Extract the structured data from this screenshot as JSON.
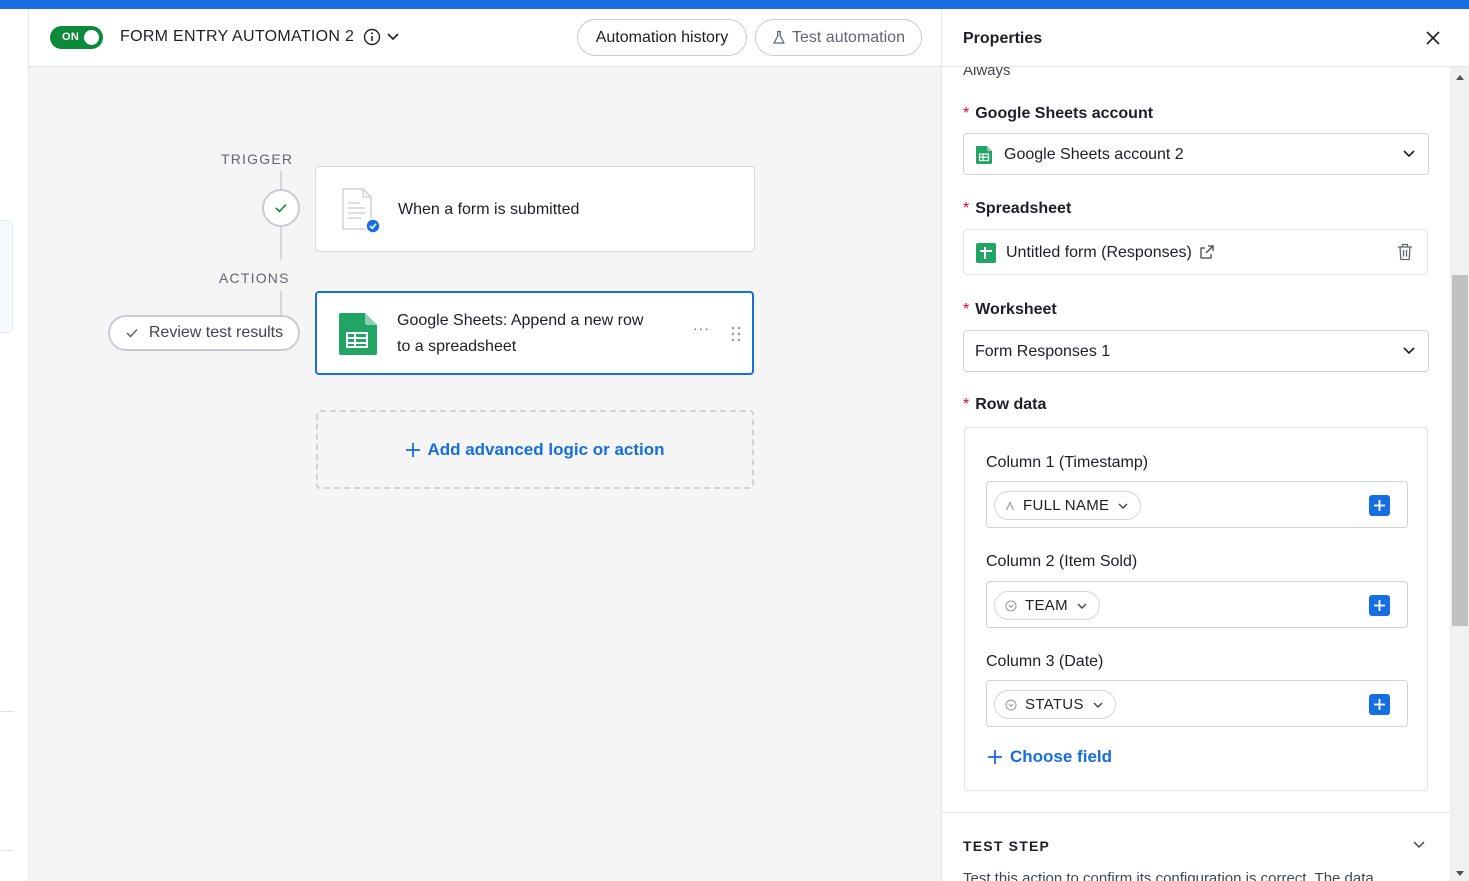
{
  "header": {
    "toggle_label": "ON",
    "title": "FORM ENTRY AUTOMATION 2",
    "history_label": "Automation history",
    "test_label": "Test automation"
  },
  "canvas": {
    "trigger_label": "TRIGGER",
    "actions_label": "ACTIONS",
    "trigger_card": "When a form is submitted",
    "action_card_line1": "Google Sheets: Append a new row",
    "action_card_line2": "to a spreadsheet",
    "review_label": "Review test results",
    "add_logic_label": "Add advanced logic or action",
    "card_menu": "···"
  },
  "panel": {
    "title": "Properties",
    "prev_value": "Always",
    "account_label": "Google Sheets account",
    "account_value": "Google Sheets account 2",
    "spreadsheet_label": "Spreadsheet",
    "spreadsheet_value": "Untitled form (Responses)",
    "worksheet_label": "Worksheet",
    "worksheet_value": "Form Responses 1",
    "row_data_label": "Row data",
    "columns": [
      {
        "label": "Column 1 (Timestamp)",
        "token": "FULL NAME",
        "token_icon": "text-icon"
      },
      {
        "label": "Column 2 (Item Sold)",
        "token": "TEAM",
        "token_icon": "single-select-icon"
      },
      {
        "label": "Column 3 (Date)",
        "token": "STATUS",
        "token_icon": "single-select-icon"
      }
    ],
    "choose_field_label": "Choose field",
    "test_step_title": "TEST STEP",
    "test_step_desc": "Test this action to confirm its configuration is correct. The data"
  },
  "colors": {
    "accent": "#166ee1",
    "toggle_on": "#0c8a3b",
    "required": "#dc043b",
    "sheets_green": "#1f9d55"
  }
}
